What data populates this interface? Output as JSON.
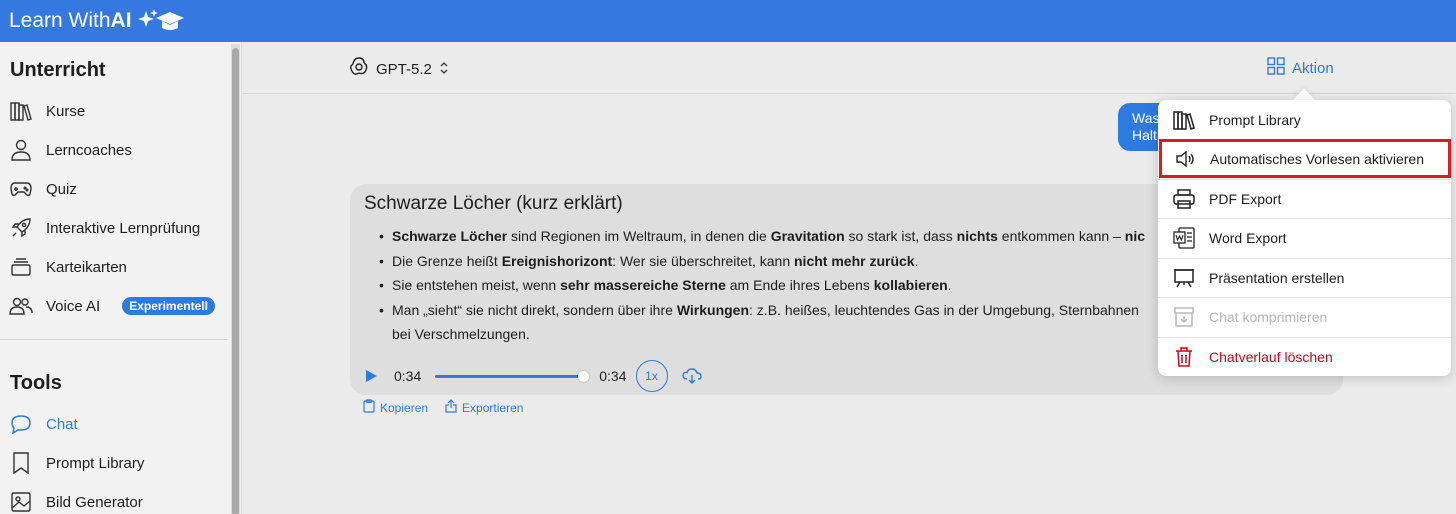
{
  "brand": {
    "text_plain": "Learn With ",
    "text_bold": "AI"
  },
  "sidebar": {
    "section1_title": "Unterricht",
    "items1": [
      {
        "label": "Kurse",
        "icon": "books-icon"
      },
      {
        "label": "Lerncoaches",
        "icon": "person-icon"
      },
      {
        "label": "Quiz",
        "icon": "gamepad-icon"
      },
      {
        "label": "Interaktive Lernprüfung",
        "icon": "rocket-icon"
      },
      {
        "label": "Karteikarten",
        "icon": "cards-icon"
      },
      {
        "label": "Voice AI",
        "icon": "people-icon",
        "badge": "Experimentell"
      }
    ],
    "section2_title": "Tools",
    "items2": [
      {
        "label": "Chat",
        "icon": "chat-bubble-icon",
        "active": true
      },
      {
        "label": "Prompt Library",
        "icon": "bookmark-icon"
      },
      {
        "label": "Bild Generator",
        "icon": "image-icon"
      }
    ]
  },
  "header": {
    "model": "GPT-5.2",
    "action": "Aktion"
  },
  "user_message": {
    "line1": "Was",
    "line2": "Halt"
  },
  "answer": {
    "title": "Schwarze Löcher (kurz erklärt)",
    "bullets": [
      [
        {
          "b": "Schwarze Löcher"
        },
        {
          "t": " sind Regionen im Weltraum, in denen die "
        },
        {
          "b": "Gravitation"
        },
        {
          "t": " so stark ist, dass "
        },
        {
          "b": "nichts"
        },
        {
          "t": " entkommen kann – "
        },
        {
          "b": "nic"
        }
      ],
      [
        {
          "t": "Die Grenze heißt "
        },
        {
          "b": "Ereignishorizont"
        },
        {
          "t": ": Wer sie überschreitet, kann "
        },
        {
          "b": "nicht mehr zurück"
        },
        {
          "t": "."
        }
      ],
      [
        {
          "t": "Sie entstehen meist, wenn "
        },
        {
          "b": "sehr massereiche Sterne"
        },
        {
          "t": " am Ende ihres Lebens "
        },
        {
          "b": "kollabieren"
        },
        {
          "t": "."
        }
      ],
      [
        {
          "t": "Man „sieht“ sie nicht direkt, sondern über ihre "
        },
        {
          "b": "Wirkungen"
        },
        {
          "t": ": z.B. heißes, leuchtendes Gas in der Umgebung, Sternbahnen"
        }
      ]
    ],
    "bullet4_line2": "bei Verschmelzungen.",
    "player": {
      "current": "0:34",
      "total": "0:34",
      "speed": "1x",
      "progress": 1.0
    },
    "copy_label": "Kopieren",
    "export_label": "Exportieren"
  },
  "menu": {
    "items": [
      {
        "label": "Prompt Library",
        "icon": "library-icon",
        "state": "normal"
      },
      {
        "label": "Automatisches Vorlesen aktivieren",
        "icon": "speaker-icon",
        "state": "highlight"
      },
      {
        "label": "PDF Export",
        "icon": "printer-icon",
        "state": "normal"
      },
      {
        "label": "Word Export",
        "icon": "word-doc-icon",
        "state": "normal"
      },
      {
        "label": "Präsentation erstellen",
        "icon": "presentation-icon",
        "state": "normal"
      },
      {
        "label": "Chat komprimieren",
        "icon": "archive-icon",
        "state": "disabled"
      },
      {
        "label": "Chatverlauf löschen",
        "icon": "trash-icon",
        "state": "danger"
      }
    ]
  },
  "colors": {
    "accent": "#2d7be0",
    "topbar": "#3478e0",
    "danger": "#d0021b",
    "highlight_border": "#e01a1a"
  }
}
